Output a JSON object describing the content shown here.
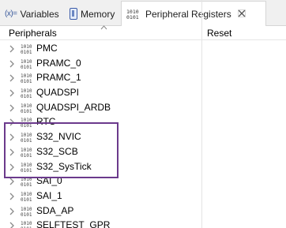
{
  "tabs": [
    {
      "label": "Variables",
      "icon": "variables-icon",
      "prefix": "(x)="
    },
    {
      "label": "Memory",
      "icon": "memory-icon"
    },
    {
      "label": "Peripheral Registers",
      "icon": "peripheral-registers-icon",
      "active": true
    }
  ],
  "table": {
    "col_peripherals": "Peripherals",
    "col_reset": "Reset"
  },
  "rows": [
    {
      "label": "PMC"
    },
    {
      "label": "PRAMC_0"
    },
    {
      "label": "PRAMC_1"
    },
    {
      "label": "QUADSPI"
    },
    {
      "label": "QUADSPI_ARDB"
    },
    {
      "label": "RTC"
    },
    {
      "label": "S32_NVIC"
    },
    {
      "label": "S32_SCB"
    },
    {
      "label": "S32_SysTick"
    },
    {
      "label": "SAI_0"
    },
    {
      "label": "SAI_1"
    },
    {
      "label": "SDA_AP"
    },
    {
      "label": "SELFTEST_GPR"
    }
  ],
  "highlight_color": "#6b3a8c",
  "icon_code": "1010\n0101"
}
